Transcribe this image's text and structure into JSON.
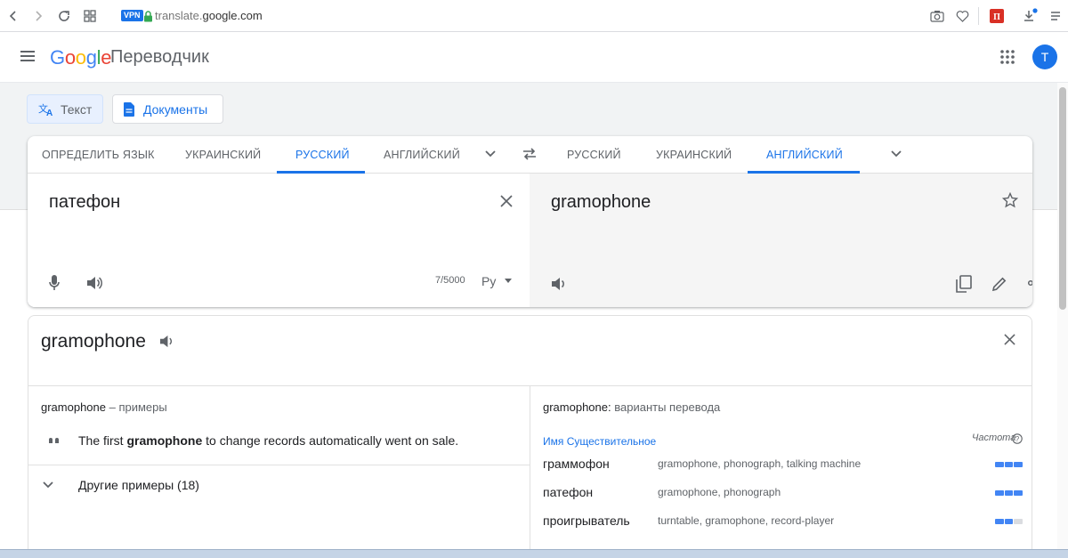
{
  "browser": {
    "vpn_label": "VPN",
    "url_prefix": "translate.",
    "url_domain": "google.com"
  },
  "app": {
    "logo": "Google",
    "product": "Переводчик",
    "avatar_letter": "T"
  },
  "modes": {
    "text_label": "Текст",
    "documents_label": "Документы"
  },
  "source_langs": [
    "ОПРЕДЕЛИТЬ ЯЗЫК",
    "УКРАИНСКИЙ",
    "РУССКИЙ",
    "АНГЛИЙСКИЙ"
  ],
  "target_langs": [
    "РУССКИЙ",
    "УКРАИНСКИЙ",
    "АНГЛИЙСКИЙ"
  ],
  "source": {
    "text": "патефон",
    "char_count": "7/5000",
    "ime_label": "Ру"
  },
  "target": {
    "text": "gramophone"
  },
  "dictionary": {
    "word": "gramophone",
    "examples_word": "gramophone",
    "examples_suffix": " – примеры",
    "example_before": "The first ",
    "example_bold": "gramophone",
    "example_after": " to change records automatically went on sale.",
    "more_examples": "Другие примеры (18)",
    "translations_word": "gramophone:",
    "translations_suffix": " варианты перевода",
    "part_of_speech": "Имя Существительное",
    "frequency_label": "Частота",
    "rows": [
      {
        "word": "граммофон",
        "back": "gramophone, phonograph, talking machine",
        "frequency": 3
      },
      {
        "word": "патефон",
        "back": "gramophone, phonograph",
        "frequency": 3
      },
      {
        "word": "проигрыватель",
        "back": "turntable, gramophone, record-player",
        "frequency": 2
      }
    ]
  }
}
